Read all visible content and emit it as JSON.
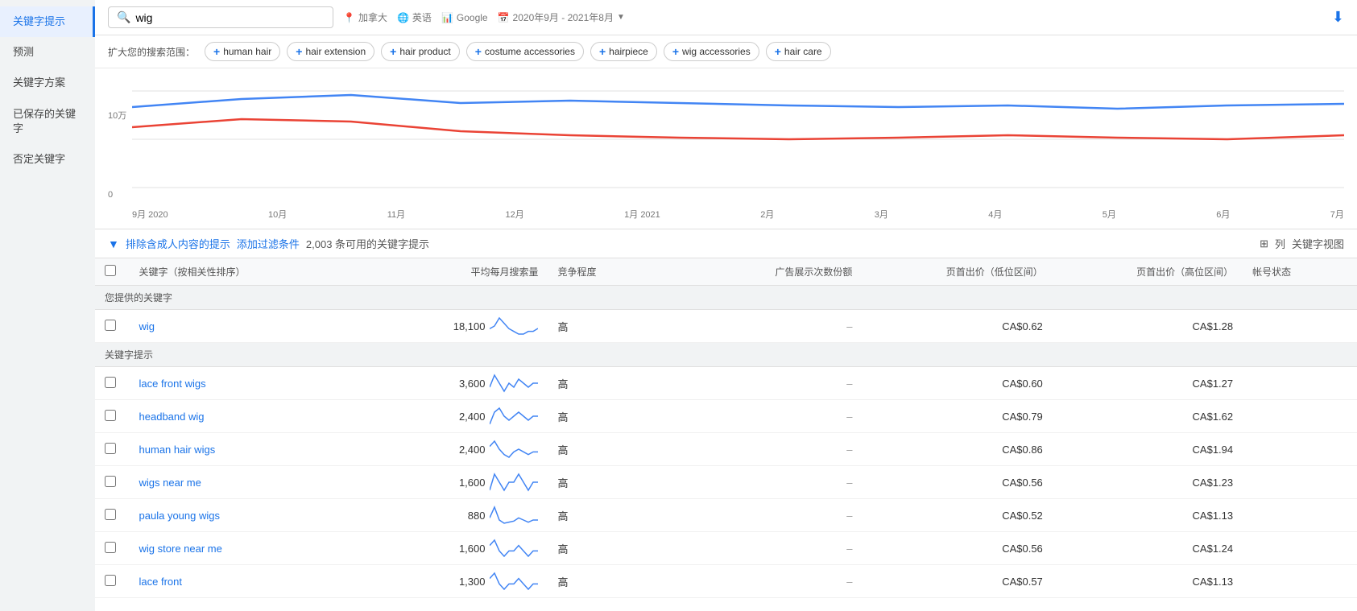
{
  "sidebar": {
    "items": [
      {
        "label": "关键字提示",
        "active": true
      },
      {
        "label": "预测",
        "active": false
      },
      {
        "label": "关键字方案",
        "active": false
      },
      {
        "label": "已保存的关键字",
        "active": false
      },
      {
        "label": "否定关键字",
        "active": false
      }
    ]
  },
  "topbar": {
    "search_placeholder": "wig",
    "search_value": "wig",
    "location": "加拿大",
    "language": "英语",
    "network": "Google",
    "date_range": "2020年9月 - 2021年8月"
  },
  "tag_bar": {
    "label": "扩大您的搜索范围：",
    "tags": [
      "human hair",
      "hair extension",
      "hair product",
      "costume accessories",
      "hairpiece",
      "wig accessories",
      "hair care"
    ]
  },
  "chart": {
    "y_label_10wan": "10万",
    "y_label_0": "0",
    "x_labels": [
      "9月 2020",
      "10月",
      "11月",
      "12月",
      "1月 2021",
      "2月",
      "3月",
      "4月",
      "5月",
      "6月",
      "7月"
    ]
  },
  "toolbar": {
    "filter_label": "排除含成人内容的提示",
    "add_filter": "添加过滤条件",
    "keyword_count": "2,003 条可用的关键字提示",
    "col_label": "列",
    "keyword_view_label": "关键字视图"
  },
  "table": {
    "headers": [
      "",
      "关键字（按相关性排序）",
      "平均每月搜索量",
      "竞争程度",
      "广告展示次数份额",
      "页首出价（低位区间）",
      "页首出价（高位区间）",
      "帐号状态"
    ],
    "section_provided": "您提供的关键字",
    "section_suggestions": "关键字提示",
    "rows_provided": [
      {
        "keyword": "wig",
        "monthly_search": "18,100",
        "competition": "高",
        "ad_impression": "–",
        "low_bid": "CA$0.62",
        "high_bid": "CA$1.28",
        "account_status": ""
      }
    ],
    "rows_suggestions": [
      {
        "keyword": "lace front wigs",
        "monthly_search": "3,600",
        "competition": "高",
        "ad_impression": "–",
        "low_bid": "CA$0.60",
        "high_bid": "CA$1.27",
        "account_status": ""
      },
      {
        "keyword": "headband wig",
        "monthly_search": "2,400",
        "competition": "高",
        "ad_impression": "–",
        "low_bid": "CA$0.79",
        "high_bid": "CA$1.62",
        "account_status": ""
      },
      {
        "keyword": "human hair wigs",
        "monthly_search": "2,400",
        "competition": "高",
        "ad_impression": "–",
        "low_bid": "CA$0.86",
        "high_bid": "CA$1.94",
        "account_status": ""
      },
      {
        "keyword": "wigs near me",
        "monthly_search": "1,600",
        "competition": "高",
        "ad_impression": "–",
        "low_bid": "CA$0.56",
        "high_bid": "CA$1.23",
        "account_status": ""
      },
      {
        "keyword": "paula young wigs",
        "monthly_search": "880",
        "competition": "高",
        "ad_impression": "–",
        "low_bid": "CA$0.52",
        "high_bid": "CA$1.13",
        "account_status": ""
      },
      {
        "keyword": "wig store near me",
        "monthly_search": "1,600",
        "competition": "高",
        "ad_impression": "–",
        "low_bid": "CA$0.56",
        "high_bid": "CA$1.24",
        "account_status": ""
      },
      {
        "keyword": "lace front",
        "monthly_search": "1,300",
        "competition": "高",
        "ad_impression": "–",
        "low_bid": "CA$0.57",
        "high_bid": "CA$1.13",
        "account_status": ""
      }
    ]
  },
  "colors": {
    "blue_line": "#4285f4",
    "red_line": "#ea4335",
    "accent": "#1a73e8"
  }
}
